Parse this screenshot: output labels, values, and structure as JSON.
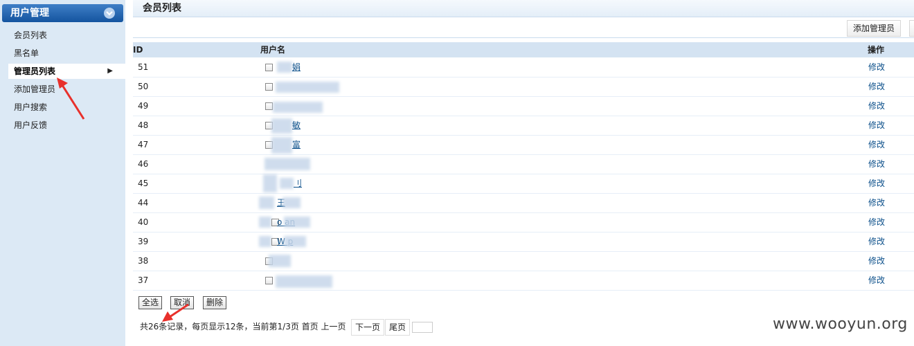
{
  "sidebar": {
    "header": "用户管理",
    "items": [
      {
        "label": "会员列表"
      },
      {
        "label": "黑名单"
      },
      {
        "label": "管理员列表"
      },
      {
        "label": "添加管理员"
      },
      {
        "label": "用户搜索"
      },
      {
        "label": "用户反馈"
      }
    ]
  },
  "main": {
    "title": "会员列表",
    "toolbar": {
      "add_admin_label": "添加管理员"
    },
    "table": {
      "headers": {
        "id": "ID",
        "username": "用户名",
        "action": "操作"
      },
      "rows": [
        {
          "id": "51",
          "username_visible": "娟",
          "action": "修改"
        },
        {
          "id": "50",
          "username_visible": "",
          "action": "修改"
        },
        {
          "id": "49",
          "username_visible": "",
          "action": "修改"
        },
        {
          "id": "48",
          "username_visible": "敏",
          "action": "修改"
        },
        {
          "id": "47",
          "username_visible": "富",
          "action": "修改"
        },
        {
          "id": "46",
          "username_visible": "",
          "action": "修改"
        },
        {
          "id": "45",
          "username_visible": "刂",
          "action": "修改"
        },
        {
          "id": "44",
          "username_visible": "王",
          "action": "修改"
        },
        {
          "id": "40",
          "username_visible": "o    an",
          "action": "修改"
        },
        {
          "id": "39",
          "username_visible": "W    p",
          "action": "修改"
        },
        {
          "id": "38",
          "username_visible": "",
          "action": "修改"
        },
        {
          "id": "37",
          "username_visible": "",
          "action": "修改"
        }
      ]
    },
    "actions": {
      "select_all": "全选",
      "cancel": "取消",
      "delete": "删除"
    },
    "pagination": {
      "summary": "共26条记录，每页显示12条，当前第1/3页 首页 上一页",
      "next": "下一页",
      "last": "尾页"
    }
  },
  "watermark": "www.wooyun.org",
  "colors": {
    "annotation_arrow": "#e8302b",
    "link": "#0b4f8a",
    "sidebar_bg": "#dce9f5"
  }
}
